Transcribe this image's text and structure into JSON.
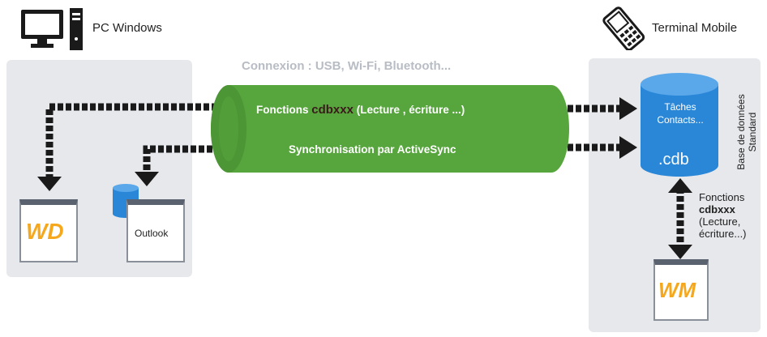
{
  "pc_label": "PC Windows",
  "mobile_label": "Terminal Mobile",
  "connection_label": "Connexion : USB, Wi-Fi, Bluetooth...",
  "pipe": {
    "line1_prefix": "Fonctions",
    "line1_accent": "cdbxxx",
    "line1_suffix": "(Lecture , écriture ...)",
    "line2": "Synchronisation par ActiveSync"
  },
  "outlook_label": "Outlook",
  "wd_logo": "WD",
  "wm_logo": "WM",
  "db": {
    "line1": "Tâches",
    "line2": "Contacts...",
    "ext": ".cdb"
  },
  "db_side_label": {
    "line1": "Base de données",
    "line2": "Standard"
  },
  "mobile_functions": {
    "line1": "Fonctions",
    "line2": "cdbxxx",
    "line3": "(Lecture,",
    "line4": "écriture...)"
  },
  "colors": {
    "pipe": "#57a53d",
    "db": "#2a87d8",
    "logo": "#f5a81c",
    "panel": "#e6e8ec",
    "arrow": "#1a1a1a"
  },
  "icons": [
    "pc-icon",
    "mobile-phone-icon",
    "database-icon"
  ]
}
